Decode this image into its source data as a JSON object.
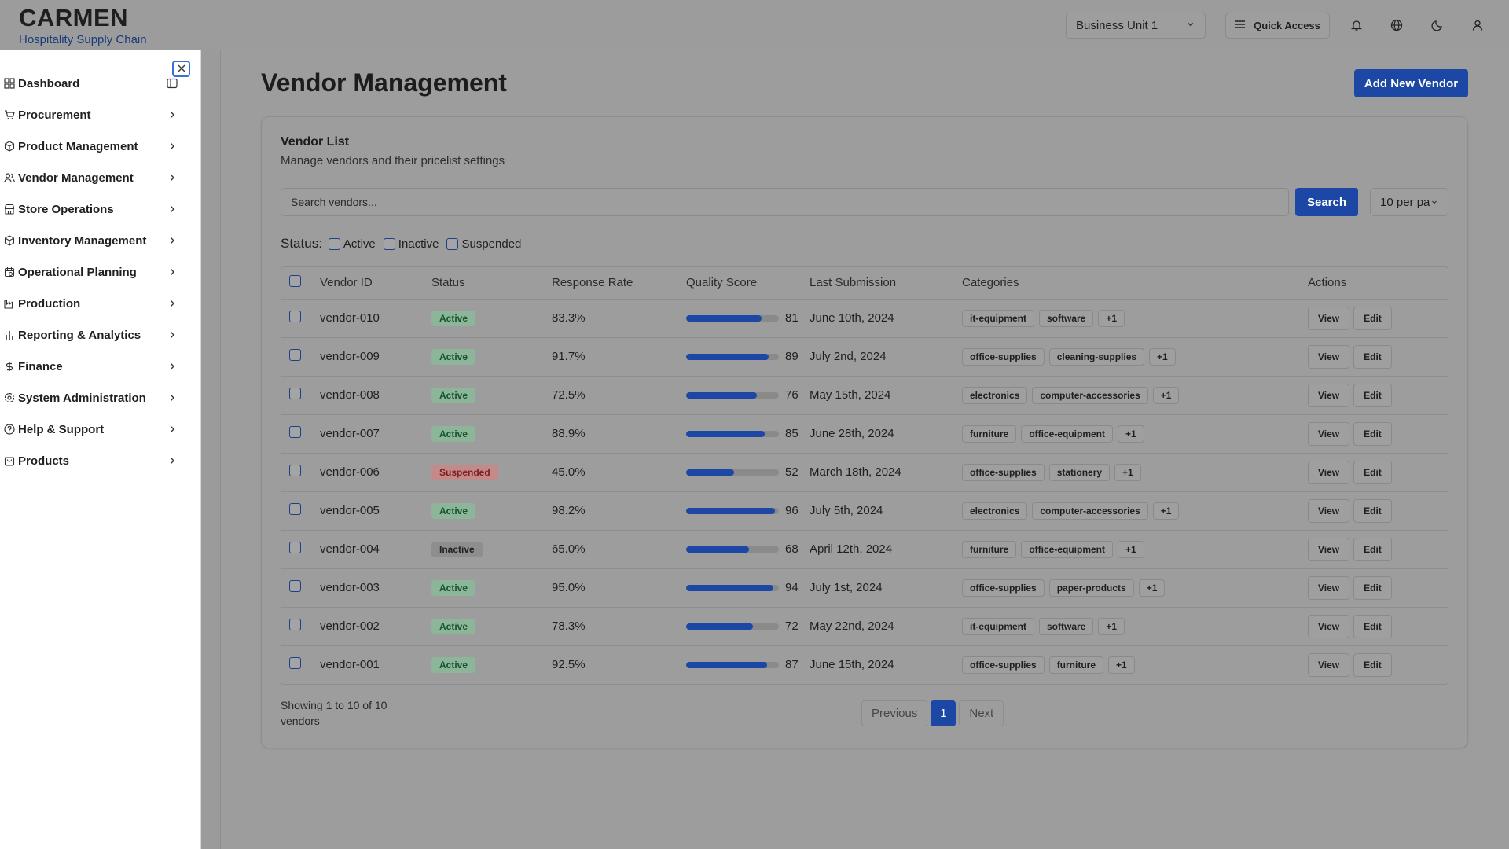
{
  "brand": {
    "name": "CARMEN",
    "subtitle": "Hospitality Supply Chain"
  },
  "header": {
    "business_unit": "Business Unit 1",
    "quick_access_label": "Quick Access",
    "icons": [
      "bell-icon",
      "globe-icon",
      "moon-icon",
      "user-icon"
    ]
  },
  "sidebar": {
    "items": [
      {
        "label": "Dashboard",
        "icon": "dashboard-icon"
      },
      {
        "label": "Procurement",
        "icon": "cart-icon"
      },
      {
        "label": "Product Management",
        "icon": "package-icon"
      },
      {
        "label": "Vendor Management",
        "icon": "users-icon"
      },
      {
        "label": "Store Operations",
        "icon": "store-icon"
      },
      {
        "label": "Inventory Management",
        "icon": "box-icon"
      },
      {
        "label": "Operational Planning",
        "icon": "calendar-icon"
      },
      {
        "label": "Production",
        "icon": "factory-icon"
      },
      {
        "label": "Reporting & Analytics",
        "icon": "bar-chart-icon"
      },
      {
        "label": "Finance",
        "icon": "dollar-icon"
      },
      {
        "label": "System Administration",
        "icon": "settings-icon"
      },
      {
        "label": "Help & Support",
        "icon": "help-icon"
      },
      {
        "label": "Products",
        "icon": "shopping-bag-icon"
      }
    ]
  },
  "page": {
    "title": "Vendor Management",
    "add_button": "Add New Vendor"
  },
  "vendor_list": {
    "title": "Vendor List",
    "subtitle": "Manage vendors and their pricelist settings",
    "search_placeholder": "Search vendors...",
    "search_button": "Search",
    "per_page": "10 per pa",
    "status_label": "Status:",
    "status_filters": [
      "Active",
      "Inactive",
      "Suspended"
    ],
    "columns": [
      "Vendor ID",
      "Status",
      "Response Rate",
      "Quality Score",
      "Last Submission",
      "Categories",
      "Actions"
    ],
    "action_labels": {
      "view": "View",
      "edit": "Edit"
    },
    "rows": [
      {
        "id": "vendor-010",
        "status": "Active",
        "response_rate": "83.3%",
        "quality_score": 81,
        "last_submission": "June 10th, 2024",
        "categories": [
          "it-equipment",
          "software",
          "+1"
        ]
      },
      {
        "id": "vendor-009",
        "status": "Active",
        "response_rate": "91.7%",
        "quality_score": 89,
        "last_submission": "July 2nd, 2024",
        "categories": [
          "office-supplies",
          "cleaning-supplies",
          "+1"
        ]
      },
      {
        "id": "vendor-008",
        "status": "Active",
        "response_rate": "72.5%",
        "quality_score": 76,
        "last_submission": "May 15th, 2024",
        "categories": [
          "electronics",
          "computer-accessories",
          "+1"
        ]
      },
      {
        "id": "vendor-007",
        "status": "Active",
        "response_rate": "88.9%",
        "quality_score": 85,
        "last_submission": "June 28th, 2024",
        "categories": [
          "furniture",
          "office-equipment",
          "+1"
        ]
      },
      {
        "id": "vendor-006",
        "status": "Suspended",
        "response_rate": "45.0%",
        "quality_score": 52,
        "last_submission": "March 18th, 2024",
        "categories": [
          "office-supplies",
          "stationery",
          "+1"
        ]
      },
      {
        "id": "vendor-005",
        "status": "Active",
        "response_rate": "98.2%",
        "quality_score": 96,
        "last_submission": "July 5th, 2024",
        "categories": [
          "electronics",
          "computer-accessories",
          "+1"
        ]
      },
      {
        "id": "vendor-004",
        "status": "Inactive",
        "response_rate": "65.0%",
        "quality_score": 68,
        "last_submission": "April 12th, 2024",
        "categories": [
          "furniture",
          "office-equipment",
          "+1"
        ]
      },
      {
        "id": "vendor-003",
        "status": "Active",
        "response_rate": "95.0%",
        "quality_score": 94,
        "last_submission": "July 1st, 2024",
        "categories": [
          "office-supplies",
          "paper-products",
          "+1"
        ]
      },
      {
        "id": "vendor-002",
        "status": "Active",
        "response_rate": "78.3%",
        "quality_score": 72,
        "last_submission": "May 22nd, 2024",
        "categories": [
          "it-equipment",
          "software",
          "+1"
        ]
      },
      {
        "id": "vendor-001",
        "status": "Active",
        "response_rate": "92.5%",
        "quality_score": 87,
        "last_submission": "June 15th, 2024",
        "categories": [
          "office-supplies",
          "furniture",
          "+1"
        ]
      }
    ],
    "showing_text": "Showing 1 to 10 of 10 vendors",
    "pagination": {
      "previous": "Previous",
      "current": "1",
      "next": "Next"
    }
  },
  "colors": {
    "primary": "#1d47a5",
    "active": "#14532d",
    "suspended": "#7f1d1d"
  }
}
